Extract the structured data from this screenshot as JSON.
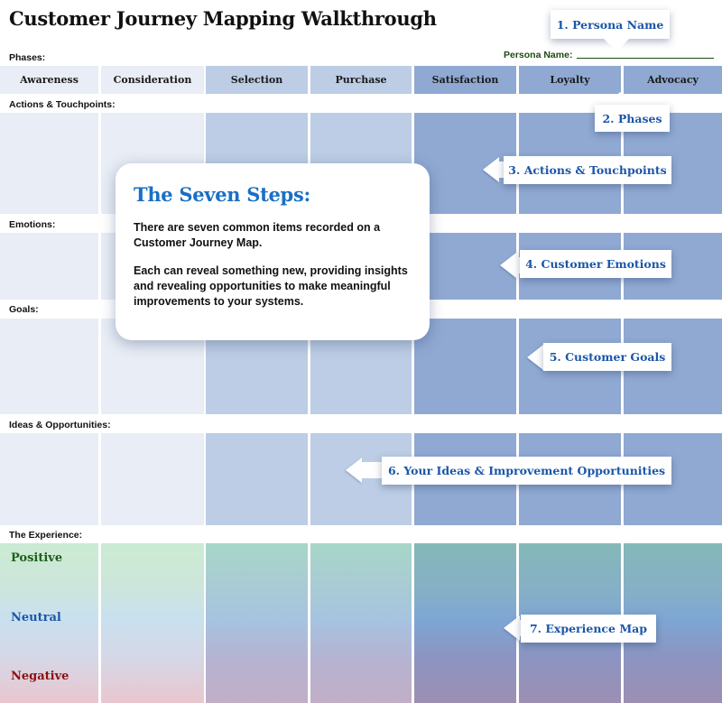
{
  "title": "Customer Journey Mapping Walkthrough",
  "persona_label": "Persona Name:",
  "sections": {
    "phases": "Phases:",
    "actions": "Actions & Touchpoints:",
    "emotions": "Emotions:",
    "goals": "Goals:",
    "ideas": "Ideas & Opportunities:",
    "experience": "The Experience:"
  },
  "phases": [
    "Awareness",
    "Consideration",
    "Selection",
    "Purchase",
    "Satisfaction",
    "Loyalty",
    "Advocacy"
  ],
  "experience_levels": {
    "positive": "Positive",
    "neutral": "Neutral",
    "negative": "Negative"
  },
  "card": {
    "heading": "The Seven Steps:",
    "para1": "There are seven common items recorded on a Customer Journey Map.",
    "para2": "Each can reveal something new, providing insights and revealing opportunities to make meaningful improvements to your systems."
  },
  "callouts": {
    "step1": "1. Persona Name",
    "step2": "2. Phases",
    "step3": "3. Actions & Touchpoints",
    "step4": "4. Customer Emotions",
    "step5": "5. Customer Goals",
    "step6": "6. Your Ideas & Improvement Opportunities",
    "step7": "7. Experience Map"
  },
  "colors": {
    "light": "#e8edf6",
    "mid": "#bccde5",
    "dark": "#8fa9d3",
    "accent_blue": "#1b56a8",
    "heading_blue": "#1a6fc4",
    "positive": "#1f5e1a",
    "neutral": "#1b56a8",
    "negative": "#8b1010"
  }
}
